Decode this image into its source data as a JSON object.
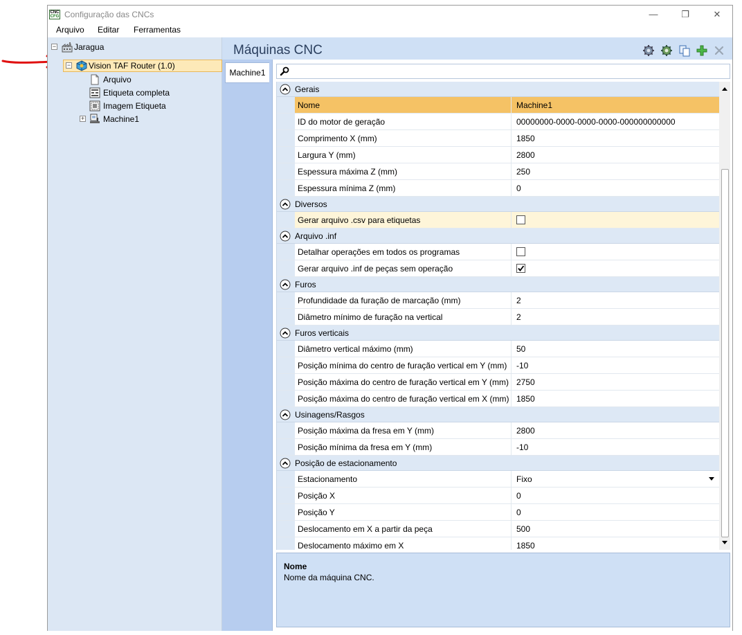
{
  "window": {
    "title": "Configuração das CNCs",
    "icon_top": "CNC",
    "icon_bottom": "CFG",
    "minimize_glyph": "—",
    "restore_glyph": "❐",
    "close_glyph": "✕"
  },
  "menu": [
    "Arquivo",
    "Editar",
    "Ferramentas"
  ],
  "tree": {
    "root": {
      "label": "Jaragua",
      "expander": "−"
    },
    "router": {
      "label": "Vision TAF Router (1.0)",
      "expander": "−"
    },
    "children": [
      "Arquivo",
      "Etiqueta completa",
      "Imagem Etiqueta"
    ],
    "machine": {
      "label": "Machine1",
      "expander": "+"
    }
  },
  "header": {
    "title": "Máquinas CNC"
  },
  "toolbar_icons": [
    "gear-settings-icon",
    "gear-refresh-icon",
    "copy-icon",
    "add-icon",
    "close-icon"
  ],
  "tab": {
    "label": "Machine1"
  },
  "search": {
    "placeholder": ""
  },
  "grid": {
    "categories": [
      {
        "label": "Gerais",
        "rows": [
          {
            "name": "Nome",
            "value": "Machine1",
            "selected": true
          },
          {
            "name": "ID do motor de geração",
            "value": "00000000-0000-0000-0000-000000000000"
          },
          {
            "name": "Comprimento X (mm)",
            "value": "1850"
          },
          {
            "name": "Largura Y (mm)",
            "value": "2800"
          },
          {
            "name": "Espessura máxima Z (mm)",
            "value": "250"
          },
          {
            "name": "Espessura mínima Z (mm)",
            "value": "0"
          }
        ]
      },
      {
        "label": "Diversos",
        "rows": [
          {
            "name": "Gerar arquivo .csv para etiquetas",
            "checkbox": true,
            "checked": false,
            "highlight": true
          }
        ]
      },
      {
        "label": "Arquivo .inf",
        "rows": [
          {
            "name": "Detalhar operações em todos os programas",
            "checkbox": true,
            "checked": false
          },
          {
            "name": "Gerar arquivo .inf de peças sem operação",
            "checkbox": true,
            "checked": true
          }
        ]
      },
      {
        "label": "Furos",
        "rows": [
          {
            "name": "Profundidade da furação de marcação (mm)",
            "value": "2"
          },
          {
            "name": "Diâmetro mínimo de furação na vertical",
            "value": "2"
          }
        ]
      },
      {
        "label": "Furos verticais",
        "rows": [
          {
            "name": "Diâmetro vertical máximo (mm)",
            "value": "50"
          },
          {
            "name": "Posição mínima do centro de furação vertical em Y (mm)",
            "value": "-10"
          },
          {
            "name": "Posição máxima do centro de furação vertical em Y (mm)",
            "value": "2750"
          },
          {
            "name": "Posição máxima do centro de furação vertical em X (mm)",
            "value": "1850"
          }
        ]
      },
      {
        "label": "Usinagens/Rasgos",
        "rows": [
          {
            "name": "Posição máxima da fresa em Y (mm)",
            "value": "2800"
          },
          {
            "name": "Posição mínima da fresa em Y (mm)",
            "value": "-10"
          }
        ]
      },
      {
        "label": "Posição de estacionamento",
        "rows": [
          {
            "name": "Estacionamento",
            "value": "Fixo",
            "dropdown": true
          },
          {
            "name": "Posição X",
            "value": "0"
          },
          {
            "name": "Posição Y",
            "value": "0"
          },
          {
            "name": "Deslocamento em X a partir da peça",
            "value": "500"
          },
          {
            "name": "Deslocamento máximo em X",
            "value": "1850"
          }
        ]
      }
    ]
  },
  "description": {
    "title": "Nome",
    "text": "Nome da máquina CNC."
  },
  "colors": {
    "selected_row": "#f5c265",
    "tree_selection": "#fde9b8",
    "panel_bg": "#cfe0f5",
    "annotation_arrow": "#e01010"
  }
}
